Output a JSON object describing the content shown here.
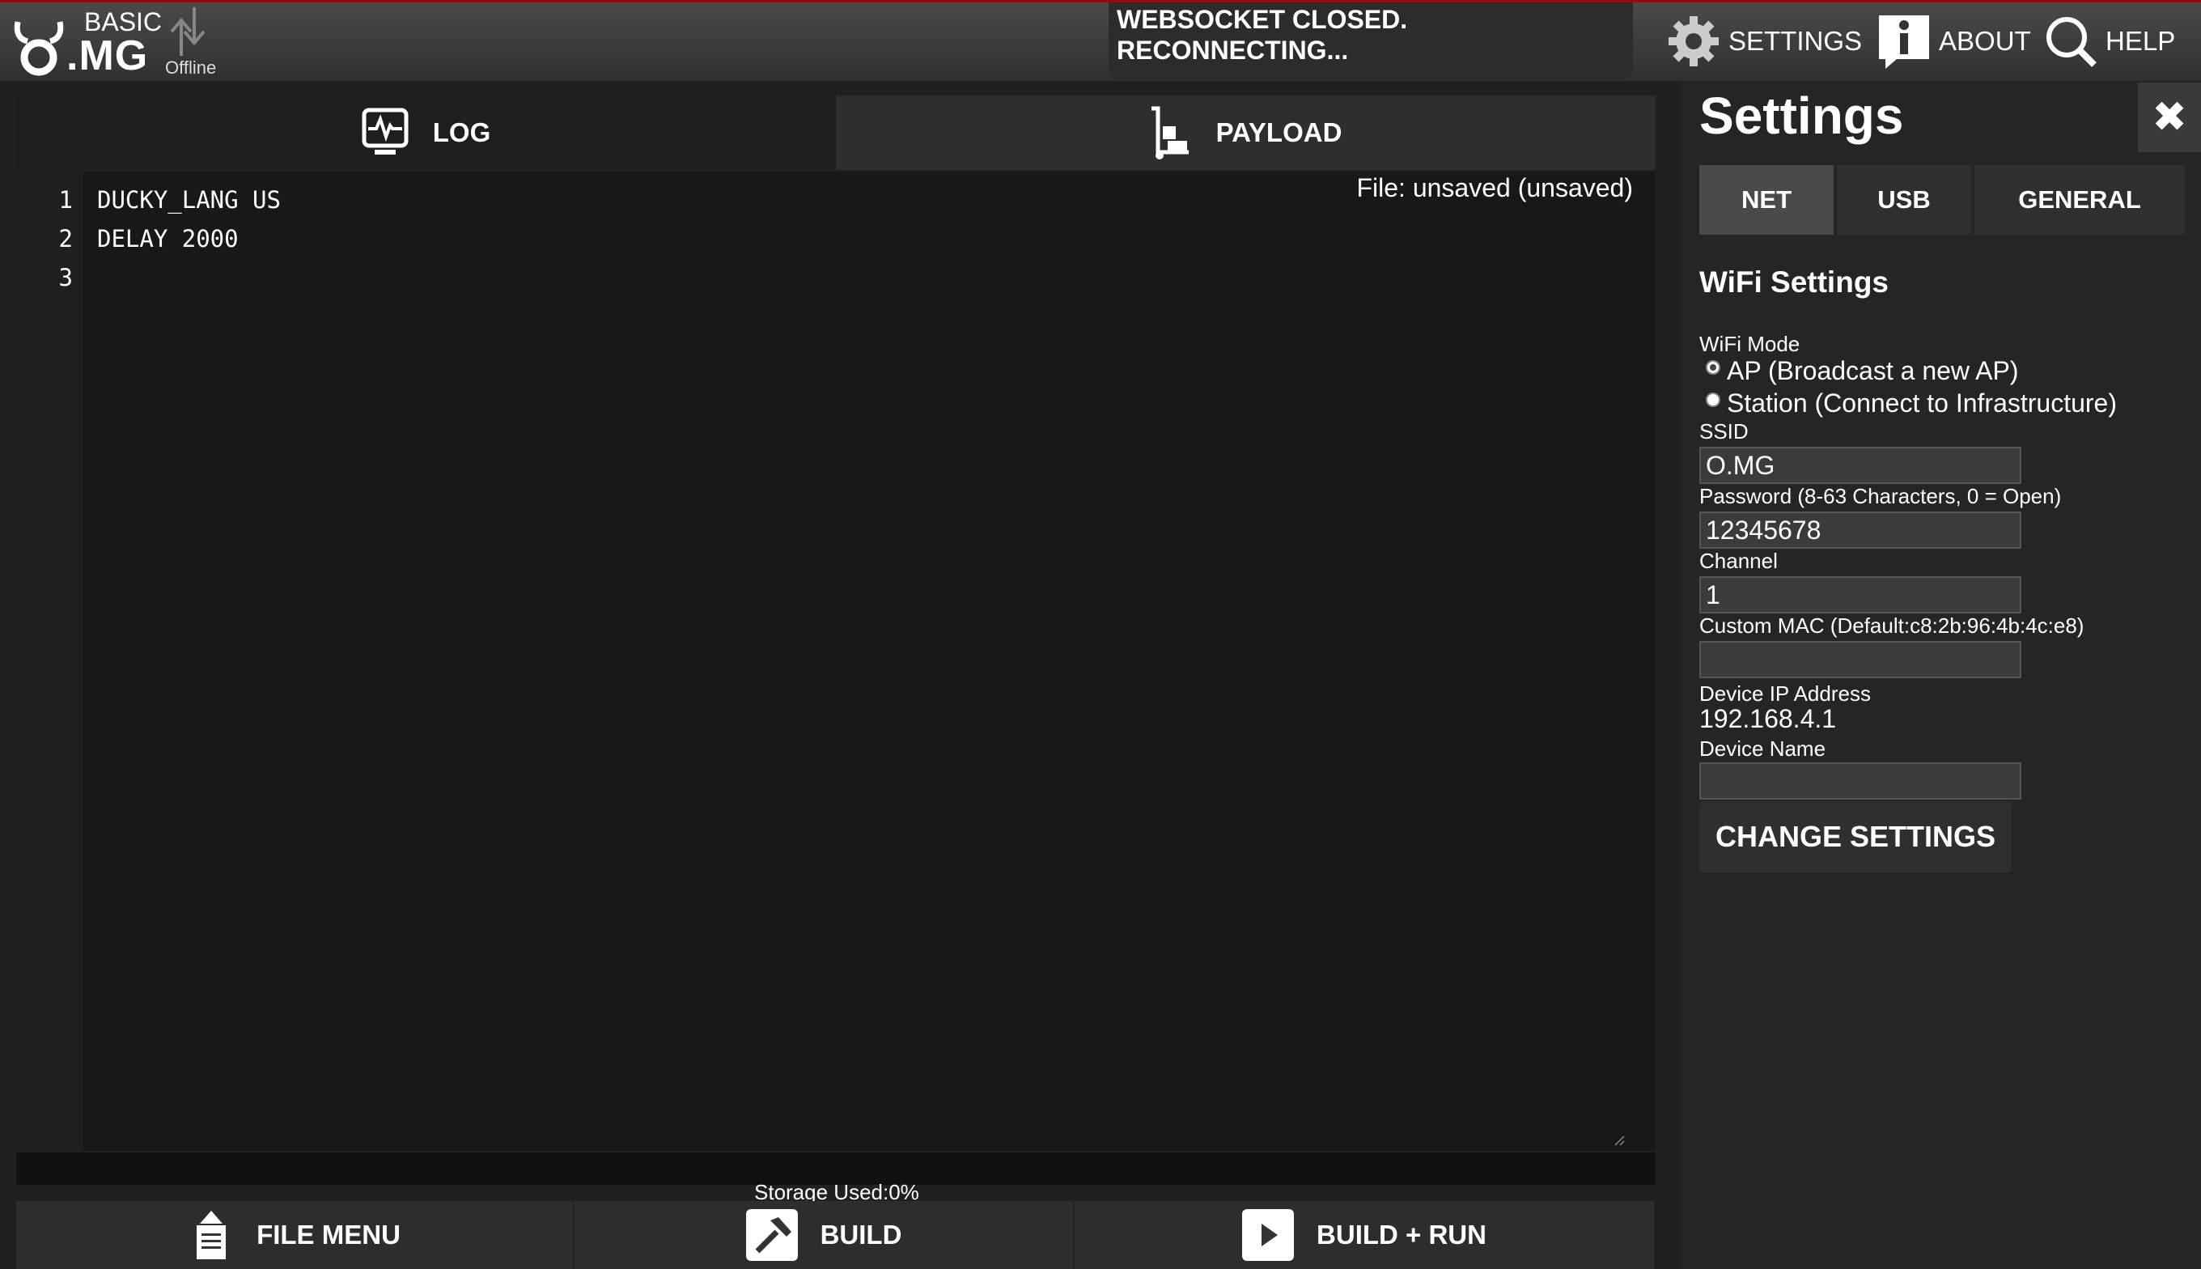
{
  "app": {
    "logo_top": "BASIC",
    "logo_main": ".MG",
    "connection_status": "Offline",
    "ws_banner": [
      "WEBSOCKET CLOSED.",
      "RECONNECTING..."
    ]
  },
  "nav": {
    "settings": "SETTINGS",
    "about": "ABOUT",
    "help": "HELP"
  },
  "tabs": {
    "log": "LOG",
    "payload": "PAYLOAD"
  },
  "editor": {
    "file_label": "File: unsaved (unsaved)",
    "lines": [
      {
        "n": "1",
        "text": "DUCKY_LANG US"
      },
      {
        "n": "2",
        "text": "DELAY 2000"
      },
      {
        "n": "3",
        "text": ""
      }
    ],
    "storage": "Storage Used:0%"
  },
  "bottom": {
    "file_menu": "FILE MENU",
    "build": "BUILD",
    "build_run": "BUILD + RUN"
  },
  "settings": {
    "title": "Settings",
    "close": "✖",
    "subtabs": {
      "net": "NET",
      "usb": "USB",
      "general": "GENERAL"
    },
    "wifi_heading": "WiFi Settings",
    "wifi_mode_label": "WiFi Mode",
    "mode_ap": "AP (Broadcast a new AP)",
    "mode_station": "Station (Connect to Infrastructure)",
    "ssid_label": "SSID",
    "ssid_value": "O.MG",
    "password_label": "Password (8-63 Characters, 0 = Open)",
    "password_value": "12345678",
    "channel_label": "Channel",
    "channel_value": "1",
    "mac_label": "Custom MAC (Default:c8:2b:96:4b:4c:e8)",
    "mac_value": "",
    "ip_label": "Device IP Address",
    "ip_value": "192.168.4.1",
    "device_name_label": "Device Name",
    "device_name_value": "",
    "change_button": "CHANGE SETTINGS"
  },
  "colors": {
    "topbar_border": "#8a1010",
    "background": "#202020",
    "editor": "#181818"
  }
}
